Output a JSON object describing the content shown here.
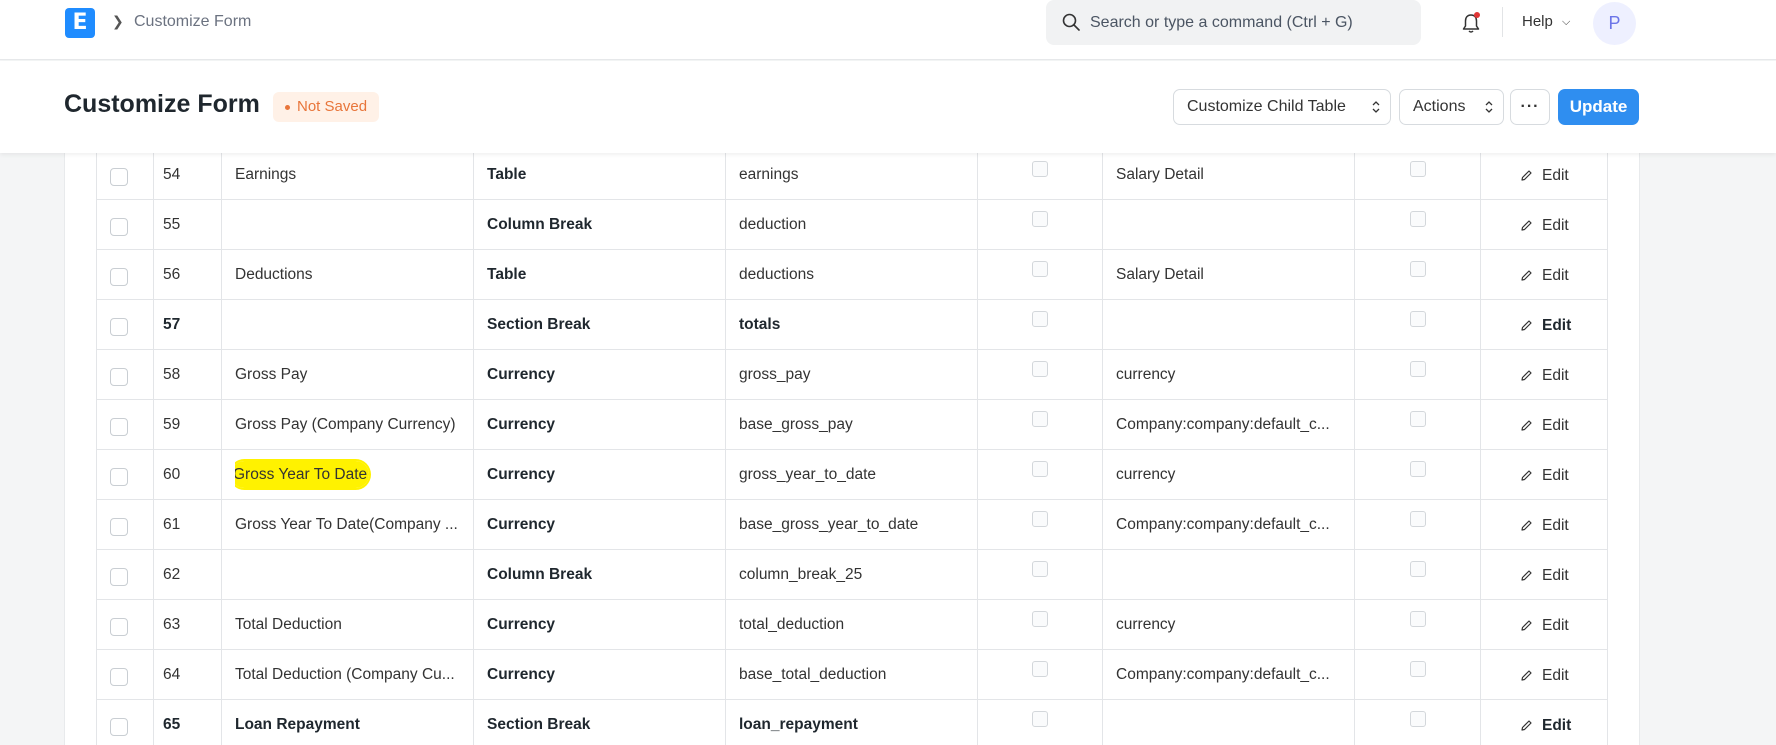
{
  "navbar": {
    "logo_letter": "E",
    "breadcrumb": "Customize Form",
    "search_placeholder": "Search or type a command (Ctrl + G)",
    "help_label": "Help",
    "avatar_letter": "P"
  },
  "page": {
    "title": "Customize Form",
    "status": "Not Saved",
    "customize_child_label": "Customize Child Table",
    "actions_label": "Actions",
    "more_label": "···",
    "update_label": "Update"
  },
  "rows": [
    {
      "idx": "54",
      "label": "Earnings",
      "type": "Table",
      "fieldname": "earnings",
      "options": "Salary Detail",
      "edit": "Edit",
      "bold": false
    },
    {
      "idx": "55",
      "label": "",
      "type": "Column Break",
      "fieldname": "deduction",
      "options": "",
      "edit": "Edit",
      "bold": false
    },
    {
      "idx": "56",
      "label": "Deductions",
      "type": "Table",
      "fieldname": "deductions",
      "options": "Salary Detail",
      "edit": "Edit",
      "bold": false
    },
    {
      "idx": "57",
      "label": "",
      "type": "Section Break",
      "fieldname": "totals",
      "options": "",
      "edit": "Edit",
      "bold": true
    },
    {
      "idx": "58",
      "label": "Gross Pay",
      "type": "Currency",
      "fieldname": "gross_pay",
      "options": "currency",
      "edit": "Edit",
      "bold": false
    },
    {
      "idx": "59",
      "label": "Gross Pay (Company Currency)",
      "type": "Currency",
      "fieldname": "base_gross_pay",
      "options": "Company:company:default_c...",
      "edit": "Edit",
      "bold": false
    },
    {
      "idx": "60",
      "label": "Gross Year To Date",
      "type": "Currency",
      "fieldname": "gross_year_to_date",
      "options": "currency",
      "edit": "Edit",
      "bold": false,
      "highlight": true
    },
    {
      "idx": "61",
      "label": "Gross Year To Date(Company ...",
      "type": "Currency",
      "fieldname": "base_gross_year_to_date",
      "options": "Company:company:default_c...",
      "edit": "Edit",
      "bold": false
    },
    {
      "idx": "62",
      "label": "",
      "type": "Column Break",
      "fieldname": "column_break_25",
      "options": "",
      "edit": "Edit",
      "bold": false
    },
    {
      "idx": "63",
      "label": "Total Deduction",
      "type": "Currency",
      "fieldname": "total_deduction",
      "options": "currency",
      "edit": "Edit",
      "bold": false
    },
    {
      "idx": "64",
      "label": "Total Deduction (Company Cu...",
      "type": "Currency",
      "fieldname": "base_total_deduction",
      "options": "Company:company:default_c...",
      "edit": "Edit",
      "bold": false
    },
    {
      "idx": "65",
      "label": "Loan Repayment",
      "type": "Section Break",
      "fieldname": "loan_repayment",
      "options": "",
      "edit": "Edit",
      "bold": true
    }
  ],
  "colors": {
    "primary": "#2f8ef0",
    "status_text": "#e8753a",
    "status_bg": "#fff1e7",
    "highlight": "#fff200"
  }
}
